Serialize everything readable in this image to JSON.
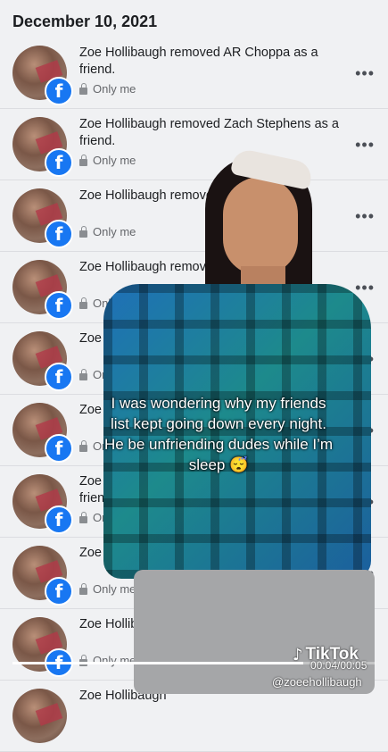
{
  "date_header": "December 10, 2021",
  "rows": [
    {
      "text": "Zoe Hollibaugh removed AR Choppa as a friend.",
      "privacy": "Only me"
    },
    {
      "text": "Zoe Hollibaugh removed Zach Stephens as a friend.",
      "privacy": "Only me"
    },
    {
      "text": "Zoe Hollibaugh removed ... as a friend.",
      "privacy": "Only me"
    },
    {
      "text": "Zoe Hollibaugh removed ... as a friend.",
      "privacy": "Only me"
    },
    {
      "text": "Zoe Hollibaugh removed ... Sr. as a friend.",
      "privacy": "Only me"
    },
    {
      "text": "Zoe Hollibaugh removed ... as a friend.",
      "privacy": "Only me"
    },
    {
      "text": "Zoe Hollibaugh removed ... Rodriguez as a friend.",
      "privacy": "Only me"
    },
    {
      "text": "Zoe Hollibaugh removed ... as a friend.",
      "privacy": "Only me"
    },
    {
      "text": "Zoe Hollibaugh removed ... as a friend.",
      "privacy": "Only me"
    },
    {
      "text": "Zoe Hollibaugh",
      "privacy": ""
    }
  ],
  "overlay": {
    "caption": "I was wondering why my friends list kept going down every night. He be unfriending dudes while I’m sleep 😴"
  },
  "video": {
    "brand": "TikTok",
    "timestamp": "00:04/00:05",
    "handle": "@zoeehollibaugh",
    "progress": 0.8
  },
  "icons": {
    "badge": "facebook-badge-icon",
    "lock": "lock-icon",
    "more": "more-options-icon",
    "logo": "tiktok-logo-icon"
  },
  "colors": {
    "facebook_blue": "#1877f2",
    "background": "#f0f1f3",
    "secondary_text": "#65676b"
  }
}
